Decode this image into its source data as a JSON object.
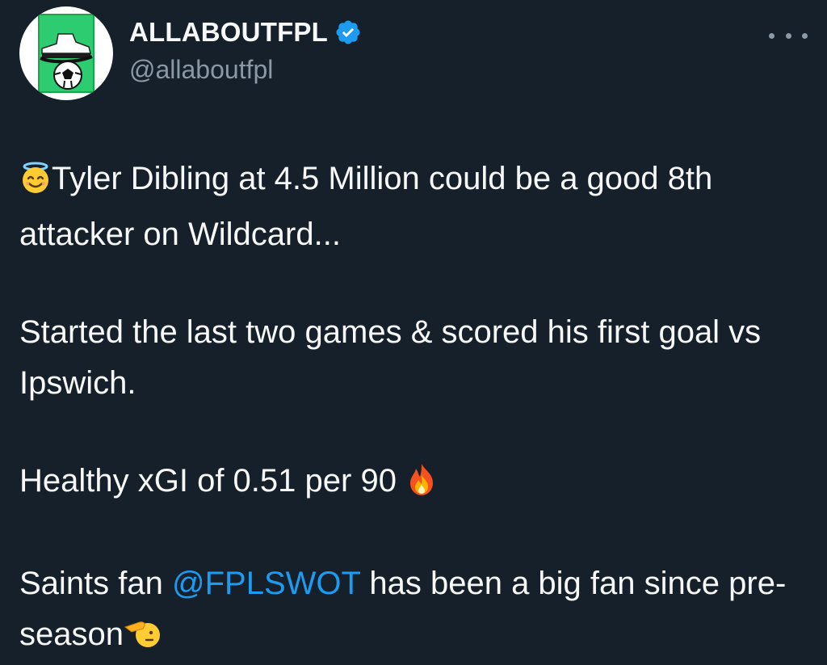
{
  "author": {
    "display_name": "ALLABOUTFPL",
    "handle": "@allaboutfpl",
    "verified": true,
    "brand_color": "#1d9bf0"
  },
  "tweet": {
    "line1_emoji": "smiling-face-with-halo-icon",
    "line1_text": "Tyler Dibling at 4.5 Million could be a good 8th attacker on Wildcard...",
    "line2_text": "Started the last two games & scored his first goal vs Ipswich.",
    "line3_text": "Healthy xGI of 0.51 per 90 ",
    "line3_emoji": "fire-icon",
    "line4_pre": "Saints fan ",
    "line4_mention": "@FPLSWOT",
    "line4_post": " has been a big fan since pre-season",
    "line4_emoji": "saluting-face-icon"
  },
  "colors": {
    "background": "#15202b",
    "text": "#f7f9f9",
    "secondary": "#8b98a5",
    "link": "#1d9bf0"
  }
}
